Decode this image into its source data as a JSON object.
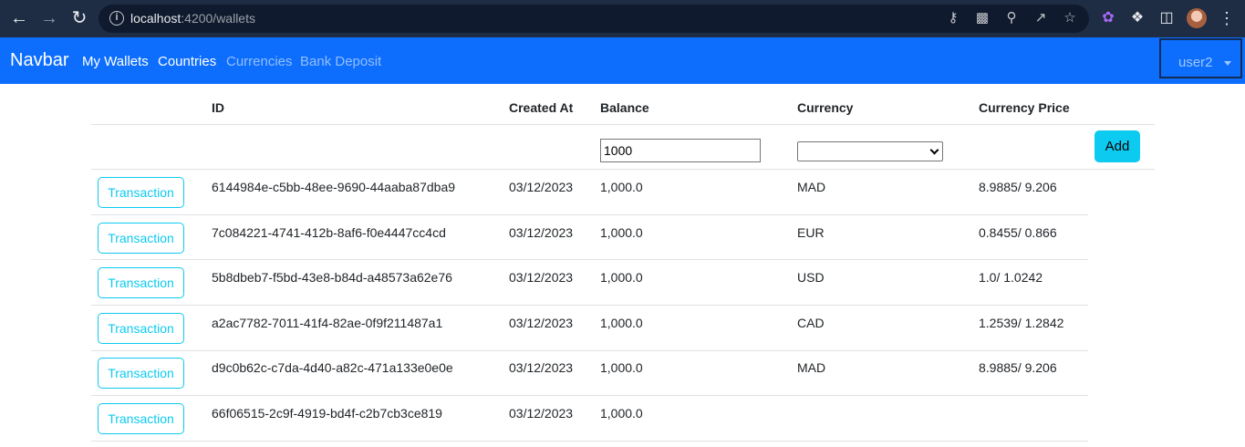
{
  "browser": {
    "url_host": "localhost",
    "url_path": ":4200/wallets"
  },
  "navbar": {
    "brand": "Navbar",
    "links": [
      "My Wallets",
      "Countries",
      "Currencies",
      "Bank Deposit"
    ],
    "user": "user2"
  },
  "table": {
    "headers": [
      "ID",
      "Created At",
      "Balance",
      "Currency",
      "Currency Price"
    ],
    "new_row": {
      "balance_value": "1000",
      "add_label": "Add"
    },
    "action_label": "Transaction",
    "rows": [
      {
        "id": "6144984e-c5bb-48ee-9690-44aaba87dba9",
        "created_at": "03/12/2023",
        "balance": "1,000.0",
        "currency": "MAD",
        "price": "8.9885/ 9.206"
      },
      {
        "id": "7c084221-4741-412b-8af6-f0e4447cc4cd",
        "created_at": "03/12/2023",
        "balance": "1,000.0",
        "currency": "EUR",
        "price": "0.8455/ 0.866"
      },
      {
        "id": "5b8dbeb7-f5bd-43e8-b84d-a48573a62e76",
        "created_at": "03/12/2023",
        "balance": "1,000.0",
        "currency": "USD",
        "price": "1.0/ 1.0242"
      },
      {
        "id": "a2ac7782-7011-41f4-82ae-0f9f211487a1",
        "created_at": "03/12/2023",
        "balance": "1,000.0",
        "currency": "CAD",
        "price": "1.2539/ 1.2842"
      },
      {
        "id": "d9c0b62c-c7da-4d40-a82c-471a133e0e0e",
        "created_at": "03/12/2023",
        "balance": "1,000.0",
        "currency": "MAD",
        "price": "8.9885/ 9.206"
      },
      {
        "id": "66f06515-2c9f-4919-bd4f-c2b7cb3ce819",
        "created_at": "03/12/2023",
        "balance": "1,000.0",
        "currency": "",
        "price": ""
      }
    ]
  }
}
